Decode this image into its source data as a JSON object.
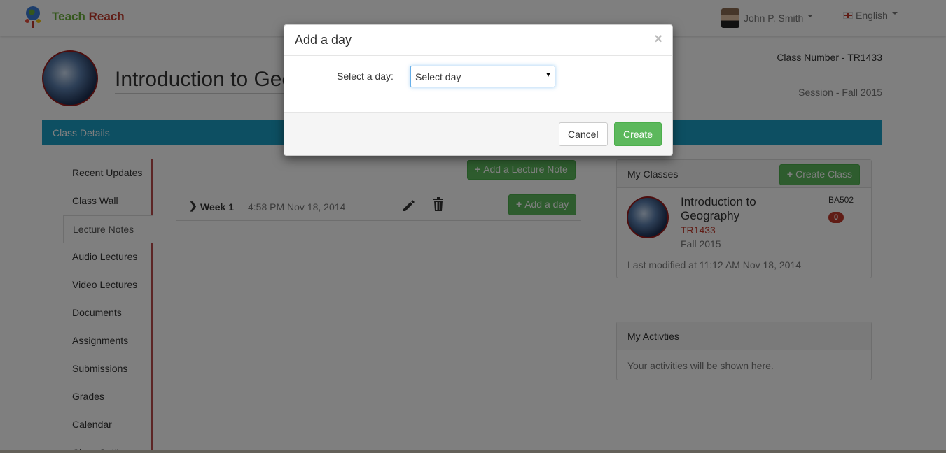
{
  "navbar": {
    "brand_teach": "Teach",
    "brand_reach": "Reach",
    "user_name": "John P. Smith",
    "language": "English"
  },
  "class_header": {
    "title": "Introduction to Geography",
    "class_number": "Class Number - TR1433",
    "session": "Session - Fall 2015",
    "details_tab": "Class Details"
  },
  "sidebar": {
    "items": [
      {
        "label": "Recent Updates"
      },
      {
        "label": "Class Wall"
      },
      {
        "label": "Lecture Notes"
      },
      {
        "label": "Audio Lectures"
      },
      {
        "label": "Video Lectures"
      },
      {
        "label": "Documents"
      },
      {
        "label": "Assignments"
      },
      {
        "label": "Submissions"
      },
      {
        "label": "Grades"
      },
      {
        "label": "Calendar"
      },
      {
        "label": "Class Setting"
      }
    ],
    "active_index": 2
  },
  "main": {
    "add_lecture_label": "Add a Lecture Note",
    "weeks": [
      {
        "label": "Week 1",
        "timestamp": "4:58 PM Nov 18, 2014",
        "add_day_label": "Add a day"
      }
    ]
  },
  "my_classes": {
    "heading": "My Classes",
    "create_label": "Create Class",
    "card": {
      "title": "Introduction to Geography",
      "number": "TR1433",
      "session": "Fall 2015",
      "code": "BA502",
      "badge": "0",
      "modified": "Last modified at 11:12 AM Nov 18, 2014"
    }
  },
  "my_activities": {
    "heading": "My Activties",
    "empty_text": "Your activities will be shown here."
  },
  "modal": {
    "title": "Add a day",
    "close_glyph": "×",
    "label": "Select a day:",
    "select_value": "Select day",
    "cancel_label": "Cancel",
    "create_label": "Create"
  },
  "colors": {
    "brand_green": "#6aaf3a",
    "brand_red": "#c0392b",
    "details_bar": "#1a9fc4",
    "success": "#5cb85c"
  },
  "icons": [
    "globe-logo-icon",
    "flag-icon",
    "chevron-right-icon",
    "pencil-icon",
    "trash-icon",
    "plus-icon",
    "close-icon",
    "dropdown-arrow-icon"
  ]
}
